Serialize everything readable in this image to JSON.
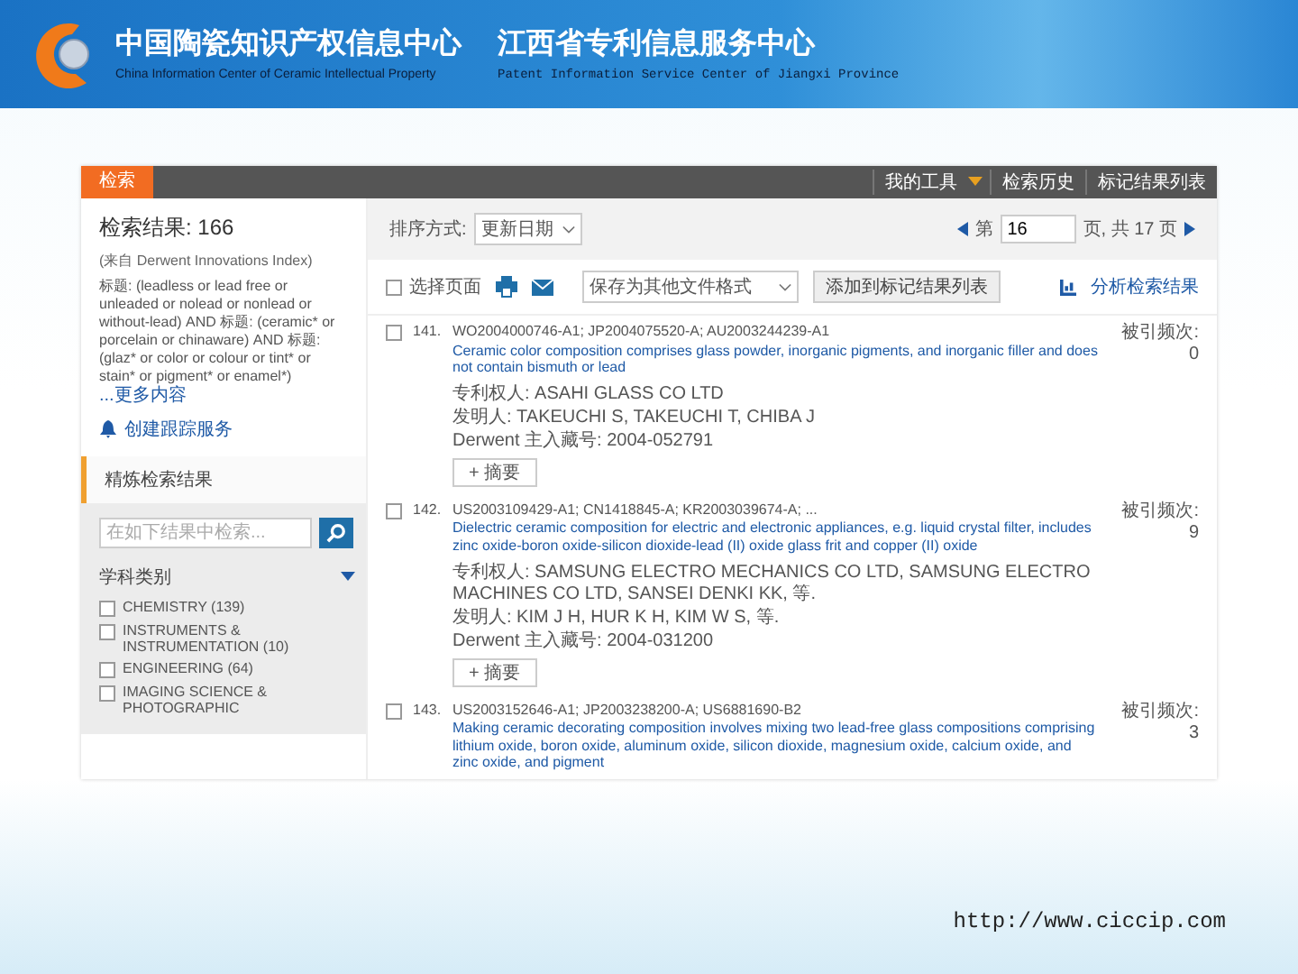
{
  "header": {
    "title_cn": "中国陶瓷知识产权信息中心",
    "title_en": "China Information Center of Ceramic Intellectual Property",
    "title2_cn": "江西省专利信息服务中心",
    "title2_en": "Patent Information Service Center of Jiangxi Province"
  },
  "nav": {
    "tabs": [
      {
        "label": "检索",
        "selected": true
      }
    ],
    "links": [
      "我的工具",
      "检索历史",
      "标记结果列表"
    ]
  },
  "summary": {
    "heading": "检索结果:",
    "count": "166",
    "source": "(来自 Derwent Innovations Index)",
    "query": "标题: (leadless or lead free or unleaded or nolead or nonlead or without-lead) AND 标题: (ceramic* or porcelain or chinaware) AND 标题: (glaz* or color or colour or tint* or stain* or pigment* or enamel*)",
    "more_link": "...更多内容",
    "alert_link": "创建跟踪服务"
  },
  "refine": {
    "heading": "精炼检索结果",
    "search": {
      "placeholder": "在如下结果中检索..."
    },
    "category": {
      "heading": "学科类别",
      "expanded": true,
      "items": [
        {
          "label": "CHEMISTRY (139)",
          "checked": false
        },
        {
          "label": "INSTRUMENTS & INSTRUMENTATION (10)",
          "checked": false
        },
        {
          "label": "ENGINEERING (64)",
          "checked": false
        },
        {
          "label": "IMAGING SCIENCE & PHOTOGRAPHIC",
          "checked": false
        }
      ]
    }
  },
  "toolbar": {
    "sort_label": "排序方式:",
    "sort_value": "更新日期",
    "page_prefix": "第",
    "page_value": "16",
    "page_suffix": "页, 共 17 页",
    "select_page": {
      "label": "选择页面",
      "checked": false
    },
    "save_select": "保存为其他文件格式",
    "add_button": "添加到标记结果列表",
    "analyze_link": "分析检索结果"
  },
  "records": [
    {
      "number": "141.",
      "ids": "WO2004000746-A1; JP2004075520-A; AU2003244239-A1",
      "title": "Ceramic color composition comprises glass powder, inorganic pigments, and inorganic filler and does not contain bismuth or lead",
      "assignee": "专利权人: ASAHI GLASS CO LTD",
      "inventor": "发明人: TAKEUCHI S, TAKEUCHI T, CHIBA J",
      "accession": "Derwent 主入藏号: 2004-052791",
      "abstract_button": "+ 摘要",
      "citations": "被引频次: 0",
      "checked": false
    },
    {
      "number": "142.",
      "ids": "US2003109429-A1; CN1418845-A; KR2003039674-A; ...",
      "title": "Dielectric ceramic composition for electric and electronic appliances, e.g. liquid crystal filter, includes zinc oxide-boron oxide-silicon dioxide-lead (II) oxide glass frit and copper (II) oxide",
      "assignee": "专利权人: SAMSUNG ELECTRO MECHANICS CO LTD, SAMSUNG ELECTRO MACHINES CO LTD, SANSEI DENKI KK, 等.",
      "inventor": "发明人: KIM J H, HUR K H, KIM W S, 等.",
      "accession": "Derwent 主入藏号: 2004-031200",
      "abstract_button": "+ 摘要",
      "citations": "被引频次: 9",
      "checked": false
    },
    {
      "number": "143.",
      "ids": "US2003152646-A1; JP2003238200-A; US6881690-B2",
      "title": "Making ceramic decorating composition involves mixing two lead-free glass compositions comprising lithium oxide, boron oxide, aluminum oxide, silicon dioxide, magnesium oxide, calcium oxide, and zinc oxide, and pigment",
      "citations": "被引频次: 3",
      "checked": false
    }
  ],
  "footer_url": "http://www.ciccip.com"
}
